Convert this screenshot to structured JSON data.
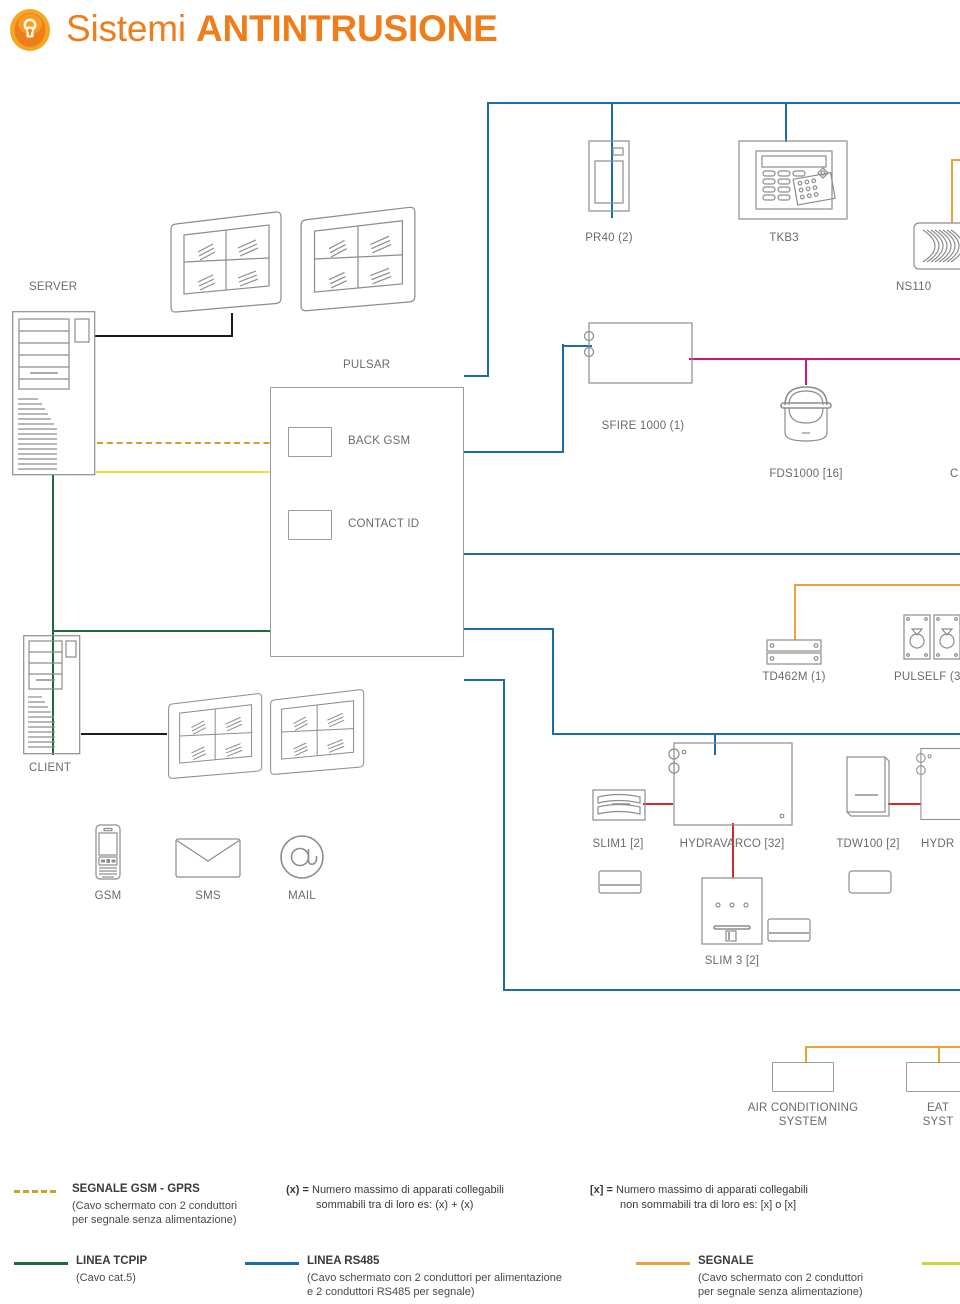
{
  "header": {
    "title_thin": "Sistemi ",
    "title_bold": "ANTINTRUSIONE",
    "logo_icon": "shield-lock-icon",
    "accent_color": "#ef7d1a"
  },
  "colors": {
    "tcpip_green": "#1c6b3c",
    "rs485_blue": "#1b6ca8",
    "segnale_orange": "#e8a33d",
    "gsm_gprs_dashed": "#c9a227",
    "yellow_line": "#e8e33a",
    "magenta_line": "#d6127a",
    "red_line": "#d42a2a",
    "yellow_green": "#cdd63a",
    "black_line": "#1c1c1c",
    "outline_grey": "#9b9b9b",
    "label_grey": "#6b6b6b"
  },
  "diagram": {
    "nodes": [
      {
        "id": "server",
        "label": "SERVER",
        "icon": "server-tower-icon"
      },
      {
        "id": "client",
        "label": "CLIENT",
        "icon": "client-tower-icon"
      },
      {
        "id": "monitor-1",
        "label": "",
        "icon": "monitor-quad-icon"
      },
      {
        "id": "monitor-2",
        "label": "",
        "icon": "monitor-quad-icon"
      },
      {
        "id": "monitor-3",
        "label": "",
        "icon": "monitor-quad-icon"
      },
      {
        "id": "monitor-4",
        "label": "",
        "icon": "monitor-quad-icon"
      },
      {
        "id": "pulsar",
        "label": "PULSAR",
        "icon": "control-panel-icon"
      },
      {
        "id": "back-gsm",
        "label": "BACK GSM",
        "icon": "module-box-icon"
      },
      {
        "id": "contact-id",
        "label": "CONTACT ID",
        "icon": "module-box-icon"
      },
      {
        "id": "gsm",
        "label": "GSM",
        "icon": "mobile-phone-icon"
      },
      {
        "id": "sms",
        "label": "SMS",
        "icon": "envelope-icon"
      },
      {
        "id": "mail",
        "label": "MAIL",
        "icon": "at-sign-icon"
      },
      {
        "id": "pr40",
        "label": "PR40 (2)",
        "icon": "reader-icon"
      },
      {
        "id": "tkb3",
        "label": "TKB3",
        "icon": "keypad-icon"
      },
      {
        "id": "ns110",
        "label": "NS110",
        "icon": "siren-icon"
      },
      {
        "id": "sfire1000",
        "label": "SFIRE 1000 (1)",
        "icon": "module-box-icon"
      },
      {
        "id": "fds1000",
        "label": "FDS1000 [16]",
        "icon": "smoke-detector-icon"
      },
      {
        "id": "cut-c",
        "label": "C",
        "icon": "cut-label"
      },
      {
        "id": "td462m",
        "label": "TD462M (1)",
        "icon": "din-module-icon"
      },
      {
        "id": "pulself",
        "label": "PULSELF (3",
        "icon": "pir-triple-icon"
      },
      {
        "id": "slim1",
        "label": "SLIM1 [2]",
        "icon": "slim-sensor-icon"
      },
      {
        "id": "hydravarco",
        "label": "HYDRAVARCO [32]",
        "icon": "expander-box-icon"
      },
      {
        "id": "tdw100",
        "label": "TDW100 [2]",
        "icon": "wall-module-icon"
      },
      {
        "id": "hydr-cut",
        "label": "HYDR",
        "icon": "expander-box-icon"
      },
      {
        "id": "slim3",
        "label": "SLIM 3 [2]",
        "icon": "slim3-sensor-icon"
      },
      {
        "id": "air-cond",
        "label": "AIR CONDITIONING SYSTEM",
        "label_l1": "AIR CONDITIONING",
        "label_l2": "SYSTEM",
        "icon": "blank-box-icon"
      },
      {
        "id": "eat-sys",
        "label": "EATING SYSTEM",
        "label_l1": "EAT",
        "label_l2": "SYST",
        "icon": "blank-box-icon"
      }
    ]
  },
  "legend": {
    "row1": [
      {
        "id": "gsm-gprs",
        "style": "dashed",
        "color": "#c9a227",
        "title": "SEGNALE GSM - GPRS",
        "sub_l1": "(Cavo schermato con 2 conduttori",
        "sub_l2": "per segnale senza alimentazione)"
      }
    ],
    "notes": [
      {
        "id": "note-round",
        "prefix": "(x)",
        "eq": " = ",
        "text_l1": "Numero massimo di apparati collegabili",
        "text_l2": "sommabili tra di loro es: (x) + (x)"
      },
      {
        "id": "note-square",
        "prefix": "[x]",
        "eq": " = ",
        "text_l1": "Numero massimo di apparati collegabili",
        "text_l2": "non sommabili tra di loro es: [x] o [x]"
      }
    ],
    "row2": [
      {
        "id": "linea-tcpip",
        "style": "solid",
        "color": "#1c6b3c",
        "title": "LINEA TCPIP",
        "sub_l1": "(Cavo cat.5)",
        "sub_l2": ""
      },
      {
        "id": "linea-rs485",
        "style": "solid",
        "color": "#1b6ca8",
        "title": "LINEA RS485",
        "sub_l1": "(Cavo schermato con 2 conduttori per alimentazione",
        "sub_l2": "e 2 conduttori RS485 per segnale)"
      },
      {
        "id": "segnale",
        "style": "solid",
        "color": "#e8a33d",
        "title": "SEGNALE",
        "sub_l1": "(Cavo schermato con 2 conduttori",
        "sub_l2": "per segnale senza alimentazione)"
      },
      {
        "id": "cut-right",
        "style": "solid",
        "color": "#cdd63a",
        "title": "",
        "sub_l1": "",
        "sub_l2": ""
      }
    ]
  }
}
